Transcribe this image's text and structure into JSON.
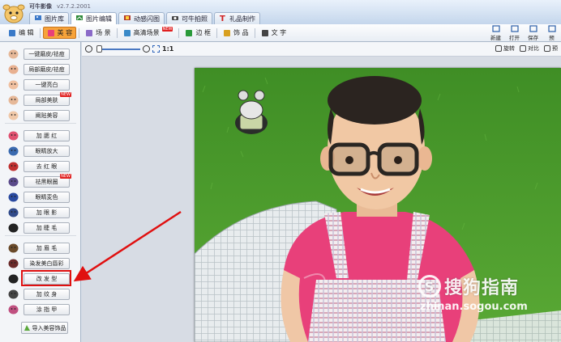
{
  "app": {
    "title": "可牛影像",
    "version": "v2.7.2.2001"
  },
  "main_tabs": [
    {
      "label": "图片库",
      "icon": "photo-library-icon",
      "color": "#3b78c8"
    },
    {
      "label": "图片编辑",
      "icon": "image-edit-icon",
      "color": "#2f8a3a",
      "active": true
    },
    {
      "label": "动感闪图",
      "icon": "film-icon",
      "color": "#b33a2a"
    },
    {
      "label": "可牛拍照",
      "icon": "camera-icon",
      "color": "#444444"
    },
    {
      "label": "礼品制作",
      "icon": "gift-icon",
      "color": "#d02020"
    }
  ],
  "sub_tabs": [
    {
      "label": "编 辑",
      "icon": "edit-icon"
    },
    {
      "label": "美 容",
      "icon": "beauty-face-icon",
      "active": true
    },
    {
      "label": "场 景",
      "icon": "scene-icon"
    },
    {
      "label": "高清场景",
      "icon": "hd-scene-icon",
      "badge": "NEW"
    },
    {
      "label": "边 框",
      "icon": "frame-icon"
    },
    {
      "label": "饰 品",
      "icon": "accessory-icon"
    },
    {
      "label": "文 字",
      "icon": "text-icon"
    }
  ],
  "right_actions": [
    {
      "label": "新建",
      "icon": "new-file-icon"
    },
    {
      "label": "打开",
      "icon": "folder-open-icon"
    },
    {
      "label": "保存",
      "icon": "save-icon"
    },
    {
      "label": "预",
      "icon": "preview-icon"
    }
  ],
  "functions": [
    {
      "label": "一键磨皮/祛痘",
      "icon": "face-smooth-icon"
    },
    {
      "label": "局部磨皮/祛痘",
      "icon": "partial-smooth-icon"
    },
    {
      "label": "一键亮白",
      "icon": "whiten-face-icon"
    },
    {
      "label": "局部美肤",
      "icon": "partial-skin-icon",
      "badge": "NEW"
    },
    {
      "label": "阐贴美容",
      "icon": "sticker-beauty-icon"
    },
    {
      "label": "加 腮 红",
      "icon": "blush-icon"
    },
    {
      "label": "眼睛放大",
      "icon": "eye-enlarge-icon"
    },
    {
      "label": "去 红 眼",
      "icon": "red-eye-icon"
    },
    {
      "label": "祛黑眼圈",
      "icon": "dark-circle-icon",
      "badge": "NEW"
    },
    {
      "label": "眼睛変色",
      "icon": "eye-color-icon"
    },
    {
      "label": "加 眼 影",
      "icon": "eye-shadow-icon"
    },
    {
      "label": "加 睫 毛",
      "icon": "eyelash-icon"
    },
    {
      "label": "加 眉 毛",
      "icon": "eyebrow-icon"
    },
    {
      "label": "染发美白唇彩",
      "icon": "hair-dye-icon"
    },
    {
      "label": "改 发 型",
      "icon": "hairstyle-icon",
      "highlighted": true
    },
    {
      "label": "加 纹 身",
      "icon": "tattoo-icon"
    },
    {
      "label": "涂 指 甲",
      "icon": "nail-polish-icon"
    }
  ],
  "import_button": "导入美容饰品",
  "zoom": {
    "level": "1:1",
    "slider_fraction": 0.05
  },
  "zoom_actions": [
    {
      "label": "旋转",
      "icon": "rotate-icon"
    },
    {
      "label": "对比",
      "icon": "compare-icon"
    },
    {
      "label": "预",
      "icon": "preview-split-icon"
    }
  ],
  "watermark": {
    "brand": "搜狗指南",
    "url": "zhinan.sogou.com"
  },
  "colors": {
    "highlight": "#e01010",
    "active_tab": "#f7a33a",
    "grass": "#4a9a2a",
    "shirt": "#e8407a"
  }
}
